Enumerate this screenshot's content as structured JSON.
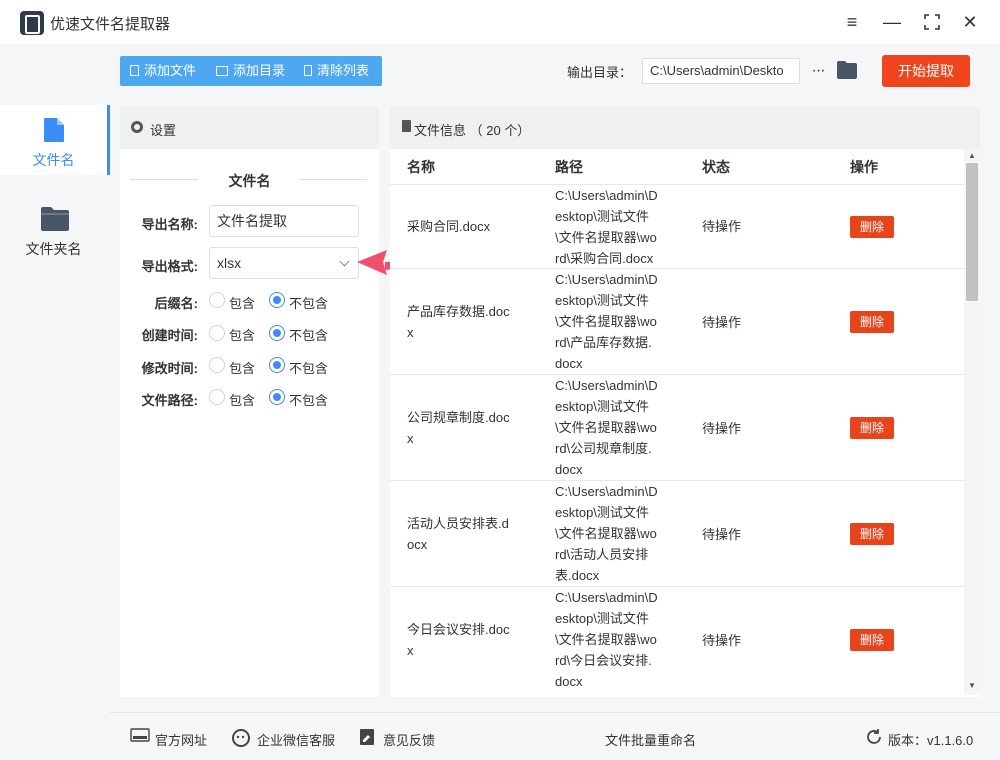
{
  "window": {
    "title": "优速文件名提取器"
  },
  "sidebar": {
    "items": [
      {
        "label": "文件名",
        "active": true,
        "icon": "file-icon"
      },
      {
        "label": "文件夹名",
        "active": false,
        "icon": "folder-icon"
      }
    ]
  },
  "toolbar": {
    "add_file": "添加文件",
    "add_dir": "添加目录",
    "clear_list": "清除列表",
    "output_label": "输出目录：",
    "output_path": "C:\\Users\\admin\\Deskto",
    "more": "···",
    "start": "开始提取"
  },
  "settings": {
    "header": "设置",
    "section": "文件名",
    "export_name_label": "导出名称:",
    "export_name_value": "文件名提取",
    "export_format_label": "导出格式:",
    "export_format_value": "xlsx",
    "options": [
      {
        "label": "后缀名:",
        "include": "包含",
        "exclude": "不包含",
        "selected": "exclude"
      },
      {
        "label": "创建时间:",
        "include": "包含",
        "exclude": "不包含",
        "selected": "exclude"
      },
      {
        "label": "修改时间:",
        "include": "包含",
        "exclude": "不包含",
        "selected": "exclude"
      },
      {
        "label": "文件路径:",
        "include": "包含",
        "exclude": "不包含",
        "selected": "exclude"
      }
    ]
  },
  "file_list": {
    "header": "文件信息 （ 20 个）",
    "columns": [
      "名称",
      "路径",
      "状态",
      "操作"
    ],
    "rows": [
      {
        "name": [
          "采购合同.docx"
        ],
        "path": [
          "C:\\Users\\admin\\D",
          "esktop\\测试文件",
          "\\文件名提取器\\wo",
          "rd\\采购合同.docx"
        ],
        "status": "待操作",
        "action": "删除"
      },
      {
        "name": [
          "产品库存数据.doc",
          "x"
        ],
        "path": [
          "C:\\Users\\admin\\D",
          "esktop\\测试文件",
          "\\文件名提取器\\wo",
          "rd\\产品库存数据.",
          "docx"
        ],
        "status": "待操作",
        "action": "删除"
      },
      {
        "name": [
          "公司规章制度.doc",
          "x"
        ],
        "path": [
          "C:\\Users\\admin\\D",
          "esktop\\测试文件",
          "\\文件名提取器\\wo",
          "rd\\公司规章制度.",
          "docx"
        ],
        "status": "待操作",
        "action": "删除"
      },
      {
        "name": [
          "活动人员安排表.d",
          "ocx"
        ],
        "path": [
          "C:\\Users\\admin\\D",
          "esktop\\测试文件",
          "\\文件名提取器\\wo",
          "rd\\活动人员安排",
          "表.docx"
        ],
        "status": "待操作",
        "action": "删除"
      },
      {
        "name": [
          "今日会议安排.doc",
          "x"
        ],
        "path": [
          "C:\\Users\\admin\\D",
          "esktop\\测试文件",
          "\\文件名提取器\\wo",
          "rd\\今日会议安排.",
          "docx"
        ],
        "status": "待操作",
        "action": "删除"
      }
    ]
  },
  "statusbar": {
    "website": "官方网址",
    "wechat": "企业微信客服",
    "feedback": "意见反馈",
    "center": "文件批量重命名",
    "version": "版本：v1.1.6.0"
  },
  "colors": {
    "accent_blue": "#3b8cf4",
    "toolbar_blue": "#4ea8f1",
    "start_red": "#f0441d",
    "delete_red": "#e8441b"
  }
}
